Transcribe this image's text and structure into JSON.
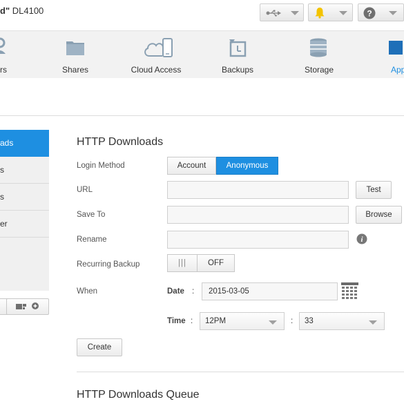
{
  "header": {
    "brand_bold": "d\"",
    "brand_model": "DL4100"
  },
  "nav": {
    "items": [
      {
        "label": "rs"
      },
      {
        "label": "Shares"
      },
      {
        "label": "Cloud Access"
      },
      {
        "label": "Backups"
      },
      {
        "label": "Storage"
      },
      {
        "label": "App"
      }
    ],
    "accent": "#1e8fe1"
  },
  "sidebar": {
    "items": [
      {
        "label": "ads"
      },
      {
        "label": "s"
      },
      {
        "label": "s"
      },
      {
        "label": "er"
      }
    ]
  },
  "form": {
    "title": "HTTP Downloads",
    "login_method_label": "Login Method",
    "login_options": [
      "Account",
      "Anonymous"
    ],
    "url_label": "URL",
    "url_value": "",
    "test_button": "Test",
    "save_to_label": "Save To",
    "save_to_value": "",
    "browse_button": "Browse",
    "rename_label": "Rename",
    "rename_value": "",
    "recurring_label": "Recurring Backup",
    "recurring_handle": "|||",
    "recurring_state": "OFF",
    "when_label": "When",
    "date_label": "Date",
    "date_colon": ":",
    "date_value": "2015-03-05",
    "time_label": "Time",
    "time_colon": ":",
    "time_colon2": ":",
    "hour_value": "12PM",
    "minute_value": "33",
    "create_button": "Create"
  },
  "queue": {
    "title": "HTTP Downloads Queue"
  }
}
